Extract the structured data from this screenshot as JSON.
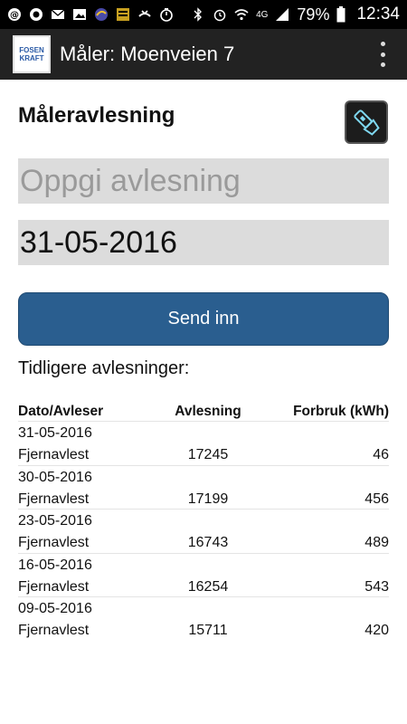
{
  "status_bar": {
    "battery_percent": "79%",
    "time": "12:34",
    "network": "4G",
    "left_icons": [
      "email-icon",
      "circle-app-icon",
      "mail-icon",
      "image-icon",
      "swirl-icon",
      "cashcard-icon",
      "missed-call-icon",
      "stopwatch-icon"
    ],
    "right_icons": [
      "bluetooth-icon",
      "alarm-icon",
      "wifi-icon",
      "signal-icon",
      "battery-icon"
    ]
  },
  "app_bar": {
    "logo_line1": "FOSEN",
    "logo_line2": "KRAFT",
    "title": "Måler: Moenveien 7"
  },
  "form": {
    "heading": "Måleravlesning",
    "reading_placeholder": "Oppgi avlesning",
    "date_value": "31-05-2016",
    "submit_label": "Send inn"
  },
  "history": {
    "title": "Tidligere avlesninger:",
    "columns": [
      "Dato/Avleser",
      "Avlesning",
      "Forbruk (kWh)"
    ],
    "rows": [
      {
        "date": "31-05-2016",
        "reader": "Fjernavlest",
        "reading": "17245",
        "usage": "46"
      },
      {
        "date": "30-05-2016",
        "reader": "Fjernavlest",
        "reading": "17199",
        "usage": "456"
      },
      {
        "date": "23-05-2016",
        "reader": "Fjernavlest",
        "reading": "16743",
        "usage": "489"
      },
      {
        "date": "16-05-2016",
        "reader": "Fjernavlest",
        "reading": "16254",
        "usage": "543"
      },
      {
        "date": "09-05-2016",
        "reader": "Fjernavlest",
        "reading": "15711",
        "usage": "420"
      }
    ]
  },
  "colors": {
    "app_bar": "#222222",
    "button": "#2a5e8f",
    "field_bg": "#dcdcdc"
  }
}
